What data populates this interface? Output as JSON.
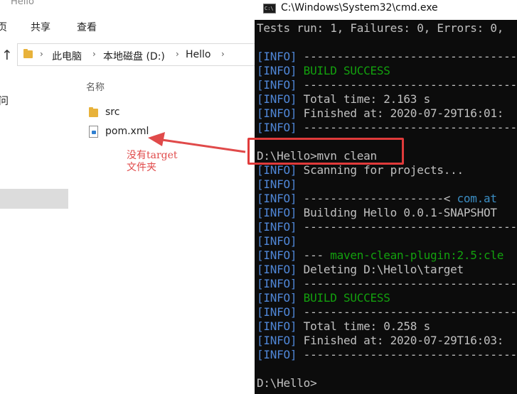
{
  "explorer": {
    "title": "Hello",
    "ribbon_tabs": [
      "页",
      "共享",
      "查看"
    ],
    "nav_fragment": "问",
    "breadcrumb": [
      "此电脑",
      "本地磁盘 (D:)",
      "Hello"
    ],
    "column_header": "名称",
    "files": [
      {
        "name": "src",
        "icon": "folder-icon"
      },
      {
        "name": "pom.xml",
        "icon": "xml-file-icon"
      }
    ]
  },
  "annotation": {
    "line1": "没有target",
    "line2": "文件夹",
    "color": "#e04a4a"
  },
  "cmd": {
    "title": "C:\\Windows\\System32\\cmd.exe",
    "lines": [
      {
        "prefix": "",
        "text": "Tests run: 1, Failures: 0, Errors: 0,",
        "style": "plain"
      },
      {
        "prefix": "",
        "text": "",
        "style": "plain"
      },
      {
        "prefix": "[INFO]",
        "text": " ------------------------------------",
        "style": "plain"
      },
      {
        "prefix": "[INFO]",
        "text": " BUILD SUCCESS",
        "style": "succ"
      },
      {
        "prefix": "[INFO]",
        "text": " ------------------------------------",
        "style": "plain"
      },
      {
        "prefix": "[INFO]",
        "text": " Total time: 2.163 s",
        "style": "plain"
      },
      {
        "prefix": "[INFO]",
        "text": " Finished at: 2020-07-29T16:01:",
        "style": "plain"
      },
      {
        "prefix": "[INFO]",
        "text": " ------------------------------------",
        "style": "plain"
      },
      {
        "prefix": "",
        "text": "",
        "style": "plain"
      },
      {
        "prefix": "",
        "text": "D:\\Hello>mvn clean",
        "style": "plain"
      },
      {
        "prefix": "[INFO]",
        "text": " Scanning for projects...",
        "style": "plain"
      },
      {
        "prefix": "[INFO]",
        "text": "",
        "style": "plain"
      },
      {
        "prefix": "[INFO]",
        "text": " ---------------------< com.at",
        "style": "cyantail"
      },
      {
        "prefix": "[INFO]",
        "text": " Building Hello 0.0.1-SNAPSHOT",
        "style": "plain"
      },
      {
        "prefix": "[INFO]",
        "text": " ------------------------------------",
        "style": "plain"
      },
      {
        "prefix": "[INFO]",
        "text": "",
        "style": "plain"
      },
      {
        "prefix": "[INFO]",
        "text": " --- maven-clean-plugin:2.5:cle",
        "style": "plugin"
      },
      {
        "prefix": "[INFO]",
        "text": " Deleting D:\\Hello\\target",
        "style": "plain"
      },
      {
        "prefix": "[INFO]",
        "text": " ------------------------------------",
        "style": "plain"
      },
      {
        "prefix": "[INFO]",
        "text": " BUILD SUCCESS",
        "style": "succ"
      },
      {
        "prefix": "[INFO]",
        "text": " ------------------------------------",
        "style": "plain"
      },
      {
        "prefix": "[INFO]",
        "text": " Total time: 0.258 s",
        "style": "plain"
      },
      {
        "prefix": "[INFO]",
        "text": " Finished at: 2020-07-29T16:03:",
        "style": "plain"
      },
      {
        "prefix": "[INFO]",
        "text": " ------------------------------------",
        "style": "plain"
      },
      {
        "prefix": "",
        "text": "",
        "style": "plain"
      },
      {
        "prefix": "",
        "text": "D:\\Hello>",
        "style": "plain"
      }
    ]
  },
  "colors": {
    "info": "#4f86d6",
    "success": "#13a10e",
    "highlight": "#e03b3b"
  }
}
